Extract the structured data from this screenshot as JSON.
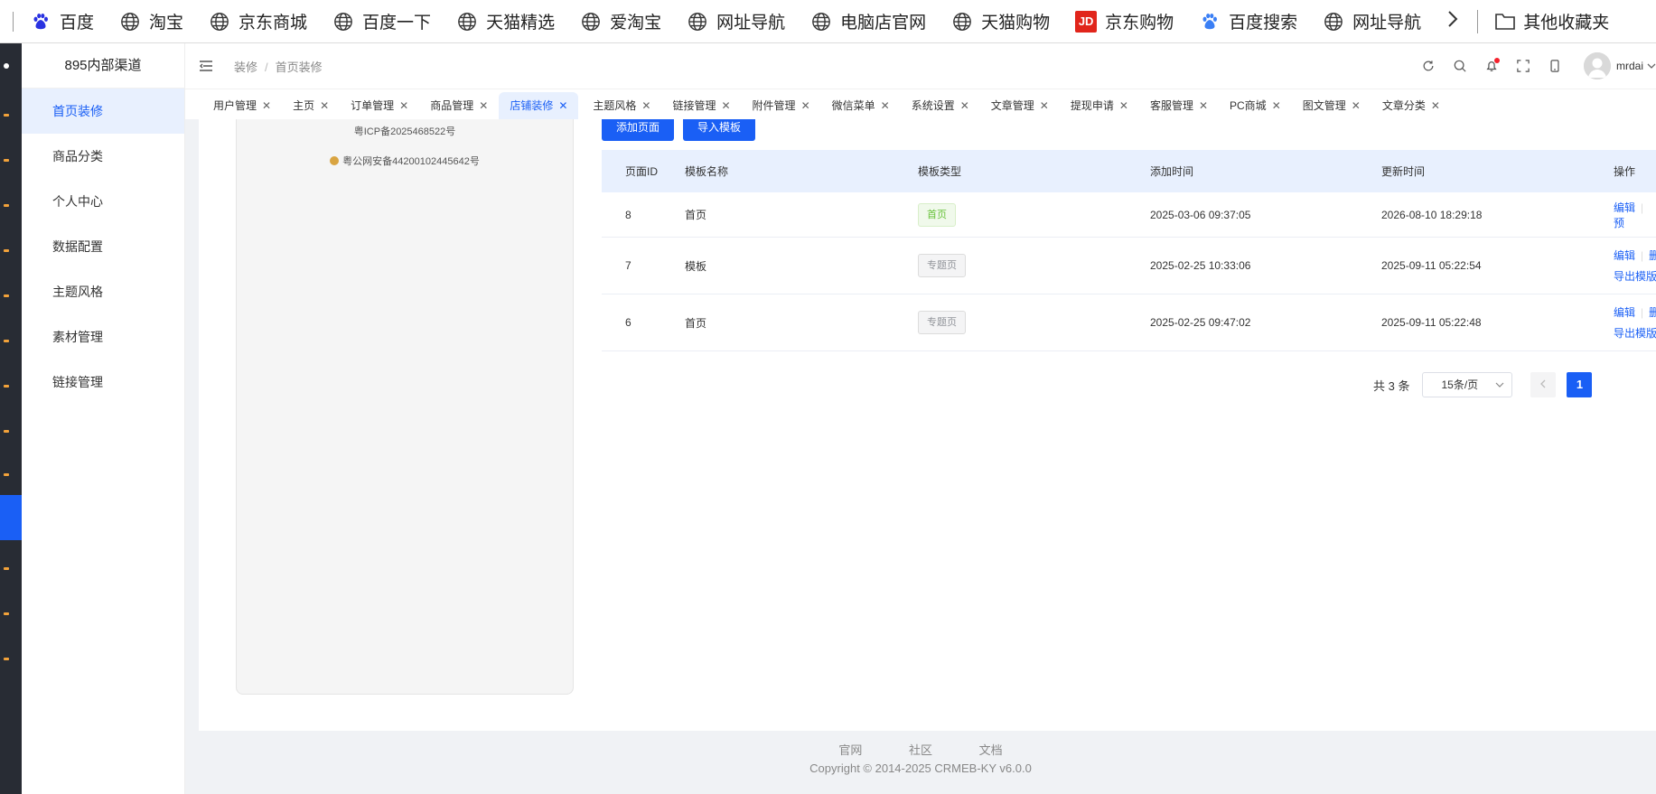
{
  "bookmarks": {
    "items": [
      {
        "label": "百度",
        "icon": "baidu-paw-icon"
      },
      {
        "label": "淘宝",
        "icon": "globe-icon"
      },
      {
        "label": "京东商城",
        "icon": "globe-icon"
      },
      {
        "label": "百度一下",
        "icon": "globe-icon"
      },
      {
        "label": "天猫精选",
        "icon": "globe-icon"
      },
      {
        "label": "爱淘宝",
        "icon": "globe-icon"
      },
      {
        "label": "网址导航",
        "icon": "globe-icon"
      },
      {
        "label": "电脑店官网",
        "icon": "globe-icon"
      },
      {
        "label": "天猫购物",
        "icon": "globe-icon"
      },
      {
        "label": "京东购物",
        "icon": "jd-logo-icon",
        "badge": "JD"
      },
      {
        "label": "百度搜索",
        "icon": "baidu-paw-icon"
      },
      {
        "label": "网址导航",
        "icon": "globe-icon"
      }
    ],
    "folder_label": "其他收藏夹"
  },
  "subsidebar": {
    "brand": "895内部渠道",
    "items": [
      {
        "label": "首页装修",
        "active": true
      },
      {
        "label": "商品分类"
      },
      {
        "label": "个人中心"
      },
      {
        "label": "数据配置"
      },
      {
        "label": "主题风格"
      },
      {
        "label": "素材管理"
      },
      {
        "label": "链接管理"
      }
    ]
  },
  "header": {
    "breadcrumb": [
      "装修",
      "首页装修"
    ],
    "breadcrumb_sep": "/",
    "username": "mrdai"
  },
  "tabs": [
    {
      "label": "用户管理"
    },
    {
      "label": "主页"
    },
    {
      "label": "订单管理"
    },
    {
      "label": "商品管理"
    },
    {
      "label": "店铺装修",
      "active": true
    },
    {
      "label": "主题风格"
    },
    {
      "label": "链接管理"
    },
    {
      "label": "附件管理"
    },
    {
      "label": "微信菜单"
    },
    {
      "label": "系统设置"
    },
    {
      "label": "文章管理"
    },
    {
      "label": "提现申请"
    },
    {
      "label": "客服管理"
    },
    {
      "label": "PC商城"
    },
    {
      "label": "图文管理"
    },
    {
      "label": "文章分类"
    }
  ],
  "preview": {
    "icp": "粤ICP备2025468522号",
    "police": "粤公网安备44200102445642号"
  },
  "actions": {
    "add_page": "添加页面",
    "import_template": "导入模板"
  },
  "table": {
    "columns": [
      "页面ID",
      "模板名称",
      "模板类型",
      "添加时间",
      "更新时间",
      "操作"
    ],
    "rows": [
      {
        "id": "8",
        "name": "首页",
        "type": "首页",
        "type_style": "green",
        "added": "2025-03-06 09:37:05",
        "updated": "2026-08-10 18:29:18",
        "ops": [
          "编辑",
          "预"
        ]
      },
      {
        "id": "7",
        "name": "模板",
        "type": "专题页",
        "type_style": "gray",
        "added": "2025-02-25 10:33:06",
        "updated": "2025-09-11 05:22:54",
        "ops": [
          "编辑",
          "删",
          "导出模版"
        ]
      },
      {
        "id": "6",
        "name": "首页",
        "type": "专题页",
        "type_style": "gray",
        "added": "2025-02-25 09:47:02",
        "updated": "2025-09-11 05:22:48",
        "ops": [
          "编辑",
          "删",
          "导出模版"
        ]
      }
    ]
  },
  "pagination": {
    "total": "共 3 条",
    "page_size": "15条/页",
    "current_page": "1"
  },
  "footer": {
    "links": [
      "官网",
      "社区",
      "文档"
    ],
    "copyright": "Copyright © 2014-2025 CRMEB-KY v6.0.0"
  },
  "colors": {
    "primary": "#1a5ff5",
    "rail_bg": "#282c34",
    "tag_green": "#67c23a"
  }
}
